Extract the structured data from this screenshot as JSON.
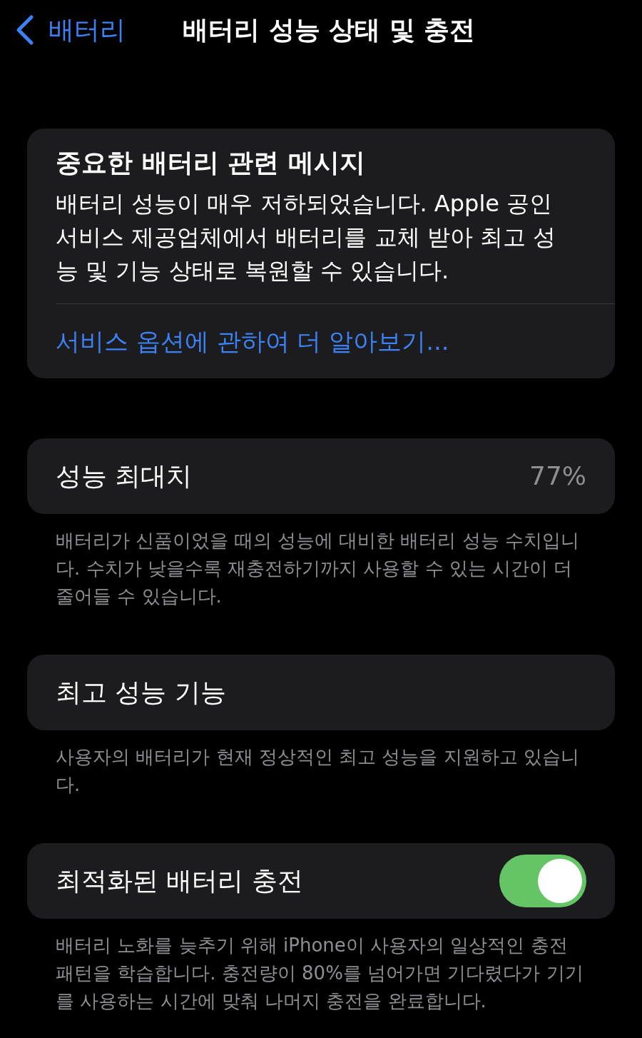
{
  "nav": {
    "back_label": "배터리",
    "title": "배터리 성능 상태 및 충전"
  },
  "message_card": {
    "title": "중요한 배터리 관련 메시지",
    "body": "배터리 성능이 매우 저하되었습니다. Apple 공인 서비스 제공업체에서 배터리를 교체 받아 최고 성능 및 기능 상태로 복원할 수 있습니다.",
    "link": "서비스 옵션에 관하여 더 알아보기..."
  },
  "sections": [
    {
      "kind": "value",
      "label": "성능 최대치",
      "value": "77%",
      "footer": "배터리가 신품이었을 때의 성능에 대비한 배터리 성능 수치입니다. 수치가 낮을수록 재충전하기까지 사용할 수 있는 시간이 더 줄어들 수 있습니다."
    },
    {
      "kind": "plain",
      "label": "최고 성능 기능",
      "footer": "사용자의 배터리가 현재 정상적인 최고 성능을 지원하고 있습니다."
    },
    {
      "kind": "toggle",
      "label": "최적화된 배터리 충전",
      "on": true,
      "footer": "배터리 노화를 늦추기 위해 iPhone이 사용자의 일상적인 충전 패턴을 학습합니다. 충전량이 80%를 넘어가면 기다렸다가 기기를 사용하는 시간에 맞춰 나머지 충전을 완료합니다."
    }
  ]
}
